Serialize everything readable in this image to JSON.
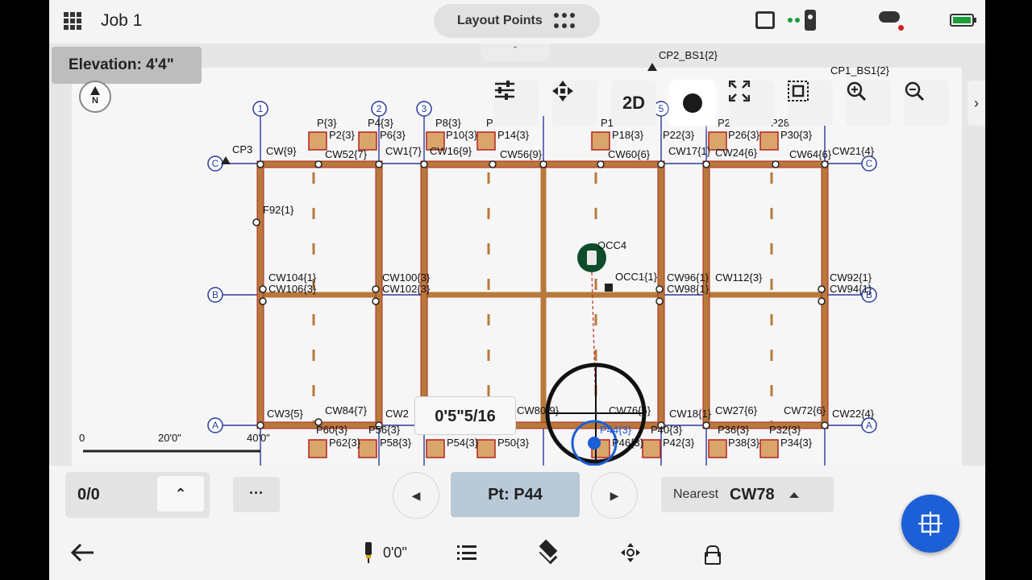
{
  "header": {
    "job_title": "Job 1",
    "mode_label": "Layout Points"
  },
  "map": {
    "elevation": "Elevation: 4'4\"",
    "north_label": "N",
    "tools": [
      "settings-sliders",
      "pan",
      "2D",
      "record",
      "fit-extents",
      "select-region",
      "zoom-in",
      "zoom-out"
    ],
    "tool_2d_label": "2D",
    "measure_value": "0'5\"5/16",
    "scale": {
      "labels": [
        "0",
        "20'0\"",
        "40'0\""
      ]
    },
    "grid": {
      "columns": [
        "1",
        "2",
        "3",
        "5"
      ],
      "rows": [
        "A",
        "B",
        "C"
      ]
    },
    "labels": {
      "cp2": "CP2_BS1{2}",
      "cp1": "CP1_BS1{2}",
      "cp3": "CP3",
      "occ4": "OCC4",
      "occ1": "OCC1{1}",
      "f92": "F92{1}",
      "p3": "P{3}",
      "p4": "P4{3}",
      "p8": "P8{3}",
      "p_cut": "P",
      "p1_cut": "P1",
      "p2_cut": "P2",
      "p28_cut": "P28",
      "p2": "P2{3}",
      "p6": "P6{3}",
      "p10": "P10{3}",
      "p14": "P14{3}",
      "p18": "P18{3}",
      "p22": "P22{3}",
      "p26": "P26{3}",
      "p30": "P30{3}",
      "cw9": "CW{9}",
      "cw52": "CW52{7}",
      "cw1": "CW1{7}",
      "cw16": "CW16{9}",
      "cw56": "CW56{9}",
      "cw60": "CW60{6}",
      "cw17": "CW17{1}",
      "cw24": "CW24{6}",
      "cw64": "CW64{6}",
      "cw21": "CW21{4}",
      "cw104": "CW104{1}",
      "cw106": "CW106{3}",
      "cw100": "CW100{3}",
      "cw102": "CW102{3}",
      "cw96": "CW96{1}",
      "cw98": "CW98{1}",
      "cw112": "CW112{3}",
      "cw92": "CW92{1}",
      "cw94": "CW94{1}",
      "cw3": "CW3{5}",
      "cw84": "CW84{7}",
      "cw2": "CW2",
      "cw80": "CW80{9}",
      "cw76": "CW76{6}",
      "cw18": "CW18{1}",
      "cw27": "CW27{6}",
      "cw72": "CW72{6}",
      "cw22": "CW22{4}",
      "p44": "P44{3}",
      "p60": "P60{3}",
      "p56": "P56{3}",
      "p62": "P62{3}",
      "p58": "P58{3}",
      "p54": "P54{3}",
      "p50": "P50{3}",
      "p46": "P46{3}",
      "p42": "P42{3}",
      "p40": "P40{3}",
      "p36": "P36{3}",
      "p32": "P32{3}",
      "p38": "P38{3}",
      "p34": "P34{3}"
    }
  },
  "controls": {
    "counter": "0/0",
    "more": "···",
    "point": "Pt: P44",
    "nearest_key": "Nearest",
    "nearest_value": "CW78"
  },
  "bottombar": {
    "offset": "0'0\""
  },
  "colors": {
    "primary": "#1c5fd6",
    "grid_line": "#2a3b9c",
    "wall": "#b77a3a",
    "wall_edge": "#b52222",
    "point_pill": "#b9c9d8"
  }
}
